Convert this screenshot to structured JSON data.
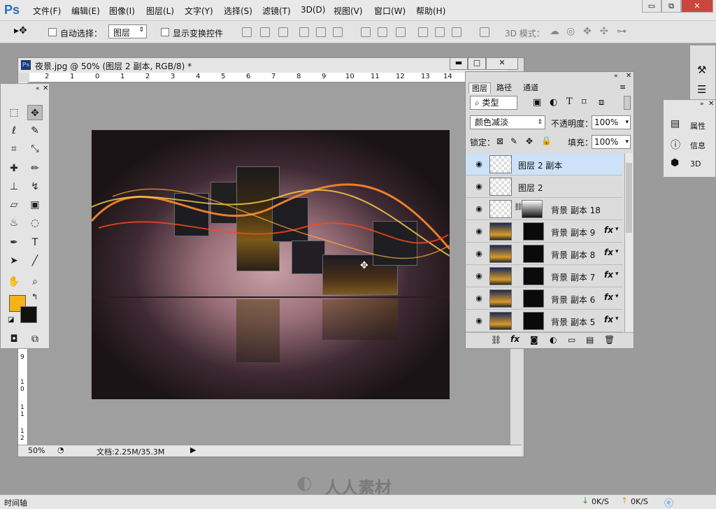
{
  "menubar": {
    "logo": "Ps",
    "items": [
      "文件(F)",
      "编辑(E)",
      "图像(I)",
      "图层(L)",
      "文字(Y)",
      "选择(S)",
      "滤镜(T)",
      "3D(D)",
      "视图(V)",
      "窗口(W)",
      "帮助(H)"
    ],
    "minimize": "▭",
    "restore": "⧉",
    "close": "✕"
  },
  "options": {
    "auto_select_label": "自动选择：",
    "auto_select_value": "图层",
    "show_transform_label": "显示变换控件",
    "mode_3d_label": "3D 模式："
  },
  "document": {
    "title": "夜景.jpg @ 50% (图层 2 副本, RGB/8) *",
    "icon": "Ps",
    "ruler_h_ticks": [
      "2",
      "1",
      "0",
      "1",
      "2",
      "3",
      "4",
      "5",
      "6",
      "7",
      "8",
      "9",
      "10",
      "11",
      "12",
      "13",
      "14"
    ],
    "ruler_v_ticks": [
      "9",
      "1 0",
      "1 1",
      "1 2"
    ],
    "zoom": "50%",
    "doc_info": "文档:2.25M/35.3M"
  },
  "layers_panel": {
    "tabs": [
      "图层",
      "路径",
      "通道"
    ],
    "filter_type": "类型",
    "blend_mode": "颜色减淡",
    "opacity_label": "不透明度：",
    "opacity_value": "100%",
    "lock_label": "锁定：",
    "fill_label": "填充：",
    "fill_value": "100%",
    "layers": [
      {
        "name": "图层 2 副本",
        "selected": true
      },
      {
        "name": "图层 2"
      },
      {
        "name": "背景 副本 18"
      },
      {
        "name": "背景 副本 9",
        "fx": "fx"
      },
      {
        "name": "背景 副本 8",
        "fx": "fx"
      },
      {
        "name": "背景 副本 7",
        "fx": "fx"
      },
      {
        "name": "背景 副本 6",
        "fx": "fx"
      },
      {
        "name": "背景 副本 5",
        "fx": "fx"
      }
    ]
  },
  "props_panel": {
    "items": [
      "属性",
      "信息",
      "3D"
    ]
  },
  "taskbar": {
    "timeline": "时间轴",
    "down_speed": "0K/S",
    "up_speed": "0K/S",
    "watermark": "人人素材"
  }
}
